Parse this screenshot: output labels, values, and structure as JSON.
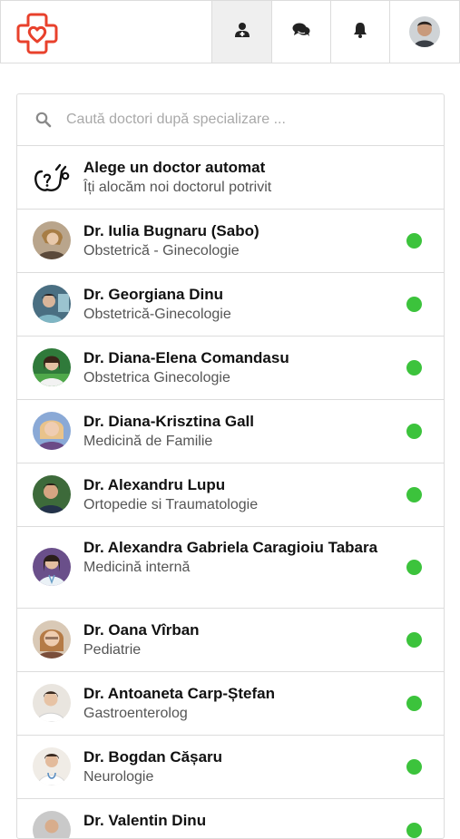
{
  "header": {
    "nav": [
      {
        "icon": "doctor-icon",
        "active": true
      },
      {
        "icon": "chat-icon",
        "active": false
      },
      {
        "icon": "bell-icon",
        "active": false
      }
    ],
    "brand_color": "#e8412c"
  },
  "search": {
    "placeholder": "Caută doctori după specializare ..."
  },
  "auto_pick": {
    "title": "Alege un doctor automat",
    "subtitle": "Îți alocăm noi doctorul potrivit"
  },
  "doctors": [
    {
      "name": "Dr. Iulia Bugnaru (Sabo)",
      "specialty": "Obstetrică - Ginecologie",
      "online": true
    },
    {
      "name": "Dr. Georgiana Dinu",
      "specialty": "Obstetrică-Ginecologie",
      "online": true
    },
    {
      "name": "Dr. Diana-Elena Comandasu",
      "specialty": "Obstetrica Ginecologie",
      "online": true
    },
    {
      "name": "Dr. Diana-Krisztina Gall",
      "specialty": "Medicină de Familie",
      "online": true
    },
    {
      "name": "Dr. Alexandru Lupu",
      "specialty": "Ortopedie si Traumatologie",
      "online": true
    },
    {
      "name": "Dr. Alexandra Gabriela Caragioiu Tabara",
      "specialty": "Medicină internă",
      "online": true
    },
    {
      "name": "Dr. Oana Vîrban",
      "specialty": "Pediatrie",
      "online": true
    },
    {
      "name": "Dr. Antoaneta Carp-Ștefan",
      "specialty": "Gastroenterolog",
      "online": true
    },
    {
      "name": "Dr. Bogdan Cășaru",
      "specialty": "Neurologie",
      "online": true
    },
    {
      "name": "Dr. Valentin Dinu",
      "specialty": "",
      "online": true
    }
  ],
  "status_color": "#3cc33c"
}
